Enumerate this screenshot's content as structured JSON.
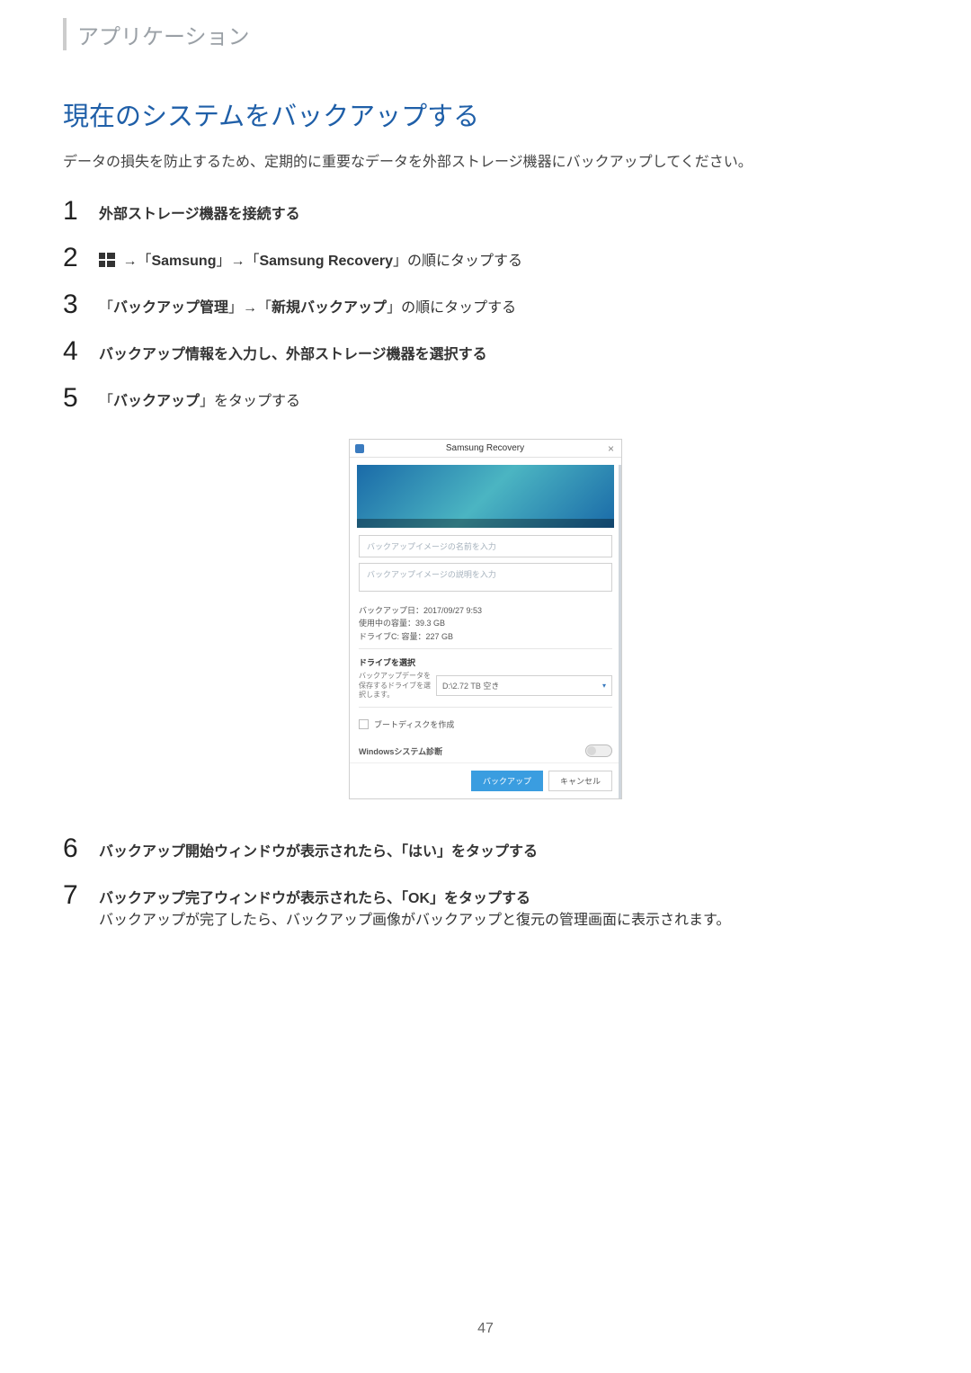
{
  "breadcrumb": "アプリケーション",
  "section_title": "現在のシステムをバックアップする",
  "intro": "データの損失を防止するため、定期的に重要なデータを外部ストレージ機器にバックアップしてください。",
  "steps": [
    {
      "num": "1",
      "parts": [
        {
          "bold": true,
          "text": "外部ストレージ機器を接続する"
        }
      ]
    },
    {
      "num": "2",
      "parts": [
        {
          "icon": "windows"
        },
        {
          "text": " →「"
        },
        {
          "bold": true,
          "text": "Samsung"
        },
        {
          "text": "」→「"
        },
        {
          "bold": true,
          "text": "Samsung Recovery"
        },
        {
          "text": "」の順にタップする"
        }
      ]
    },
    {
      "num": "3",
      "parts": [
        {
          "text": "「"
        },
        {
          "bold": true,
          "text": "バックアップ管理"
        },
        {
          "text": "」→「"
        },
        {
          "bold": true,
          "text": "新規バックアップ"
        },
        {
          "text": "」の順にタップする"
        }
      ]
    },
    {
      "num": "4",
      "parts": [
        {
          "bold": true,
          "text": "バックアップ情報を入力し、外部ストレージ機器を選択する"
        }
      ]
    },
    {
      "num": "5",
      "parts": [
        {
          "text": "「"
        },
        {
          "bold": true,
          "text": "バックアップ"
        },
        {
          "text": "」をタップする"
        }
      ]
    },
    {
      "num": "6",
      "parts": [
        {
          "bold": true,
          "text": "バックアップ開始ウィンドウが表示されたら、「はい」をタップする"
        }
      ]
    },
    {
      "num": "7",
      "parts": [
        {
          "bold": true,
          "text": "バックアップ完了ウィンドウが表示されたら、「OK」をタップする"
        },
        {
          "br": true
        },
        {
          "text": "バックアップが完了したら、バックアップ画像がバックアップと復元の管理画面に表示されます。"
        }
      ]
    }
  ],
  "dialog": {
    "title": "Samsung Recovery",
    "name_placeholder": "バックアップイメージの名前を入力",
    "desc_placeholder": "バックアップイメージの説明を入力",
    "meta": {
      "date": "バックアップ日：2017/09/27 9:53",
      "used": "使用中の容量：39.3 GB",
      "drive_c": "ドライブC: 容量：227 GB"
    },
    "drive_section": "ドライブを選択",
    "drive_label": "バックアップデータを保存するドライブを選択します。",
    "drive_value": "D:\\2.72 TB 空き",
    "boot_disk": "ブートディスクを作成",
    "diag_label": "Windowsシステム診断",
    "btn_backup": "バックアップ",
    "btn_cancel": "キャンセル"
  },
  "page_number": "47"
}
